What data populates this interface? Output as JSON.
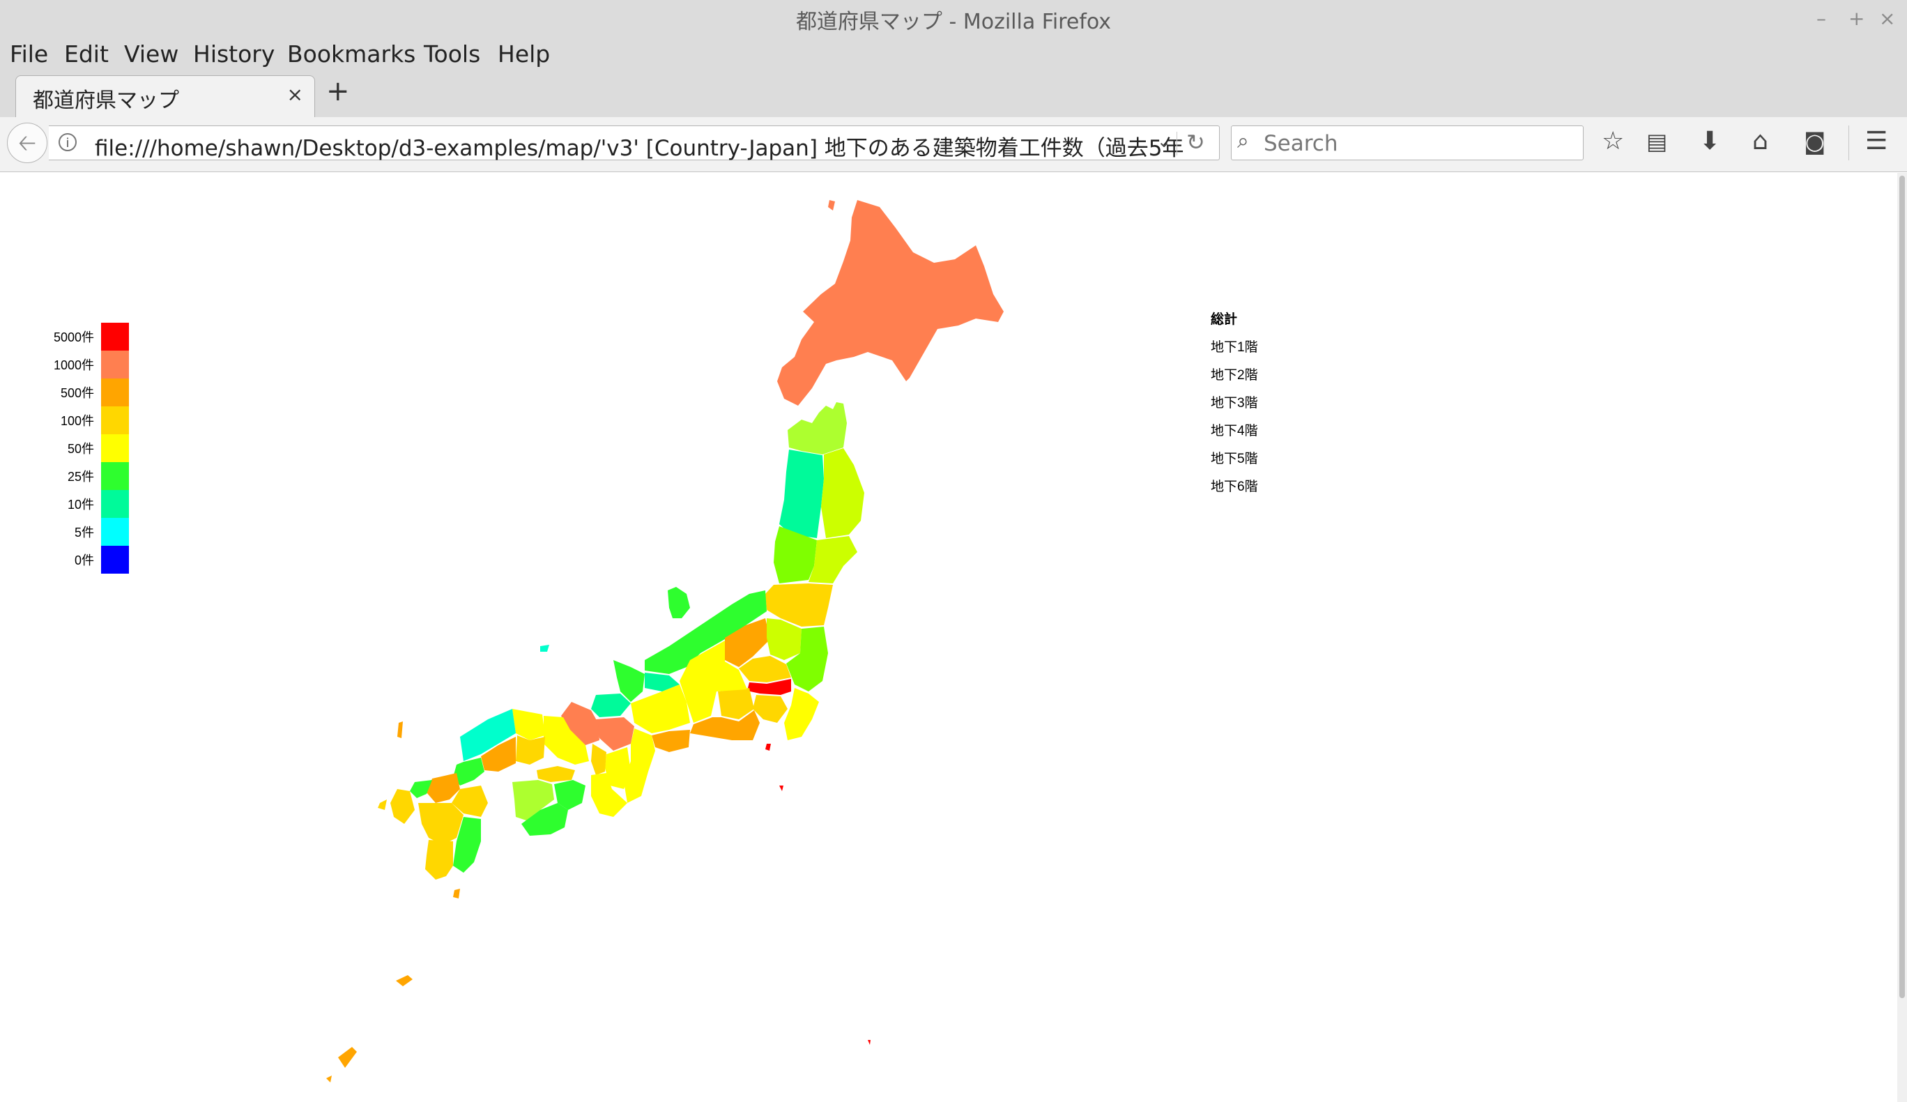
{
  "window": {
    "title": "都道府県マップ - Mozilla Firefox",
    "controls": [
      "–",
      "+",
      "×"
    ]
  },
  "menu": [
    "File",
    "Edit",
    "View",
    "History",
    "Bookmarks",
    "Tools",
    "Help"
  ],
  "tab": {
    "title": "都道府県マップ",
    "close": "×",
    "new_tab": "+"
  },
  "navbar": {
    "url": "file:///home/shawn/Desktop/d3-examples/map/'v3' [Country-Japan] 地下のある建築物着工件数（過去5年",
    "search_placeholder": "Search"
  },
  "legend": {
    "items": [
      {
        "label": "5000件",
        "color": "#ff0000"
      },
      {
        "label": "1000件",
        "color": "#ff7f50"
      },
      {
        "label": "500件",
        "color": "#ffa500"
      },
      {
        "label": "100件",
        "color": "#ffd700"
      },
      {
        "label": "50件",
        "color": "#ffff00"
      },
      {
        "label": "25件",
        "color": "#2efe2e"
      },
      {
        "label": "10件",
        "color": "#00fa9a"
      },
      {
        "label": "5件",
        "color": "#00ffff"
      },
      {
        "label": "0件",
        "color": "#0000ff"
      }
    ]
  },
  "floor_menu": {
    "heading": "総計",
    "items": [
      "地下1階",
      "地下2階",
      "地下3階",
      "地下4階",
      "地下5階",
      "地下6階"
    ]
  },
  "map_colors": {
    "hokkaido": "#ff7f50",
    "tohoku_north": "#adff2f",
    "tohoku_akita": "#00fa9a",
    "tohoku_iwate": "#ccff00",
    "tohoku_middle": "#7fff00",
    "kanto": "#ffd700",
    "kanto_light": "#ffff00",
    "tokyo": "#ff0000",
    "chubu_yellow": "#ffff00",
    "chubu_orange": "#ffa500",
    "chubu_light": "#ccff00",
    "niigata": "#2efe2e",
    "hokuriku": "#00fa9a",
    "kansai_coral": "#ff7f50",
    "kansai_yellow": "#ffff00",
    "chugoku": "#ffd700",
    "chugoku_green": "#2efe2e",
    "sanin": "#00ffcc",
    "shikoku": "#2efe2e",
    "shikoku_light": "#adff2f",
    "kyushu": "#ffd700",
    "kyushu_orange": "#ffa500",
    "kyushu_green": "#2efe2e",
    "okinawa": "#ffa500"
  }
}
